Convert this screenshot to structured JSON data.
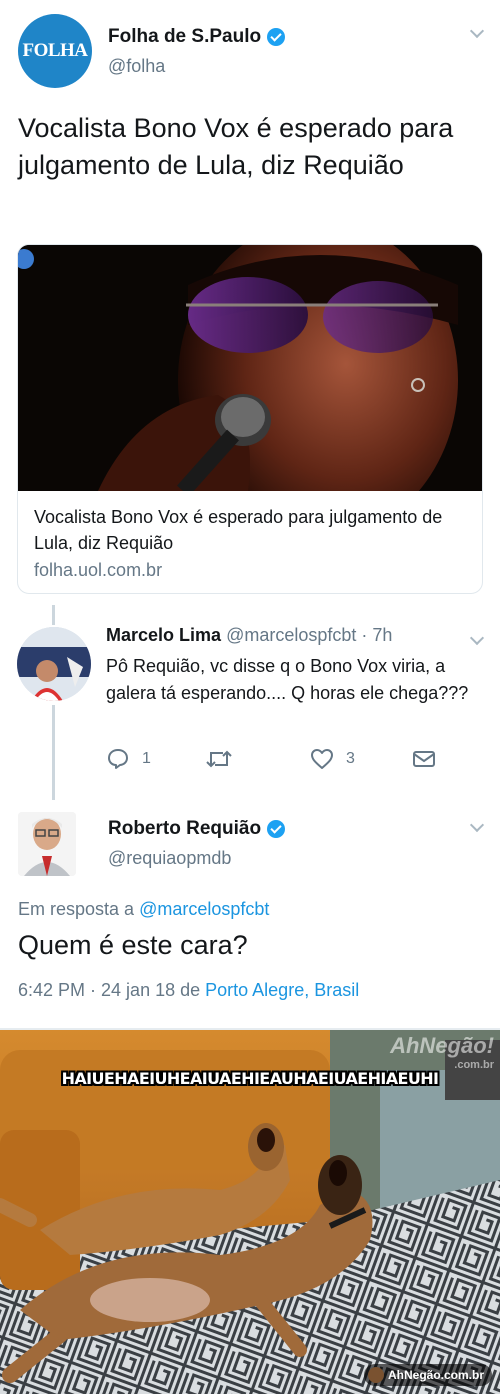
{
  "tweet": {
    "avatar_text": "FOLHA",
    "name": "Folha de S.Paulo",
    "handle": "@folha",
    "text": "Vocalista Bono Vox é esperado para julgamento de Lula, diz Requião",
    "card": {
      "title": "Vocalista Bono Vox é esperado para julgamento de Lula, diz Requião",
      "url": "folha.uol.com.br"
    }
  },
  "reply": {
    "name": "Marcelo Lima",
    "handle_time": "@marcelospfcbt · 7h",
    "text": "Pô Requião, vc disse q o Bono Vox viria, a galera tá esperando.... Q horas ele chega???",
    "actions": {
      "reply_count": "1",
      "retweet_count": "",
      "like_count": "3"
    }
  },
  "tweet2": {
    "name": "Roberto Requião",
    "handle": "@requiaopmdb",
    "in_reply_prefix": "Em resposta a",
    "in_reply_handle": "@marcelospfcbt",
    "text": "Quem é este cara?",
    "time": "6:42 PM · 24 jan 18 de",
    "location": "Porto Alegre, Brasil"
  },
  "meme": {
    "caption": "HAIUEHAEIUHEAIUAEHIEAUHAEIUAEHIAEUHI",
    "watermark_top": "AhNegão!",
    "watermark_top_sub": ".com.br",
    "watermark_bottom": "AhNegão.com.br"
  },
  "colors": {
    "link": "#1b95e0",
    "verified": "#1da1f2",
    "secondary_text": "#657786",
    "folha_blue": "#1f85c8"
  }
}
